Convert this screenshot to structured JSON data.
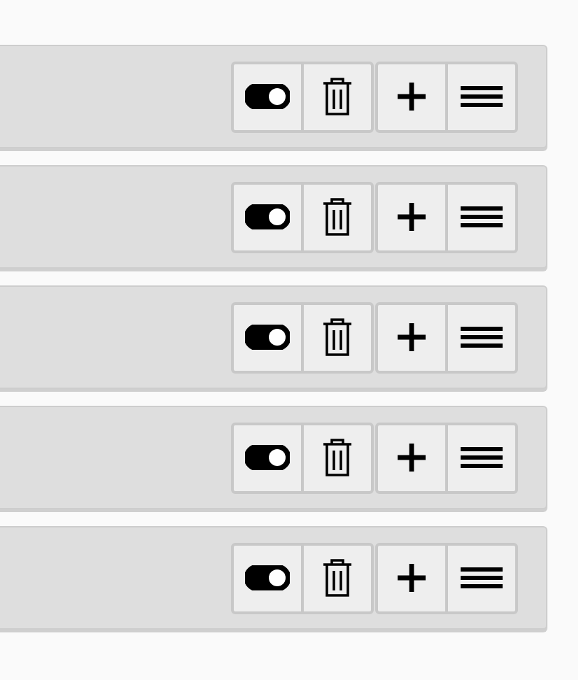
{
  "rows": [
    {
      "on": true
    },
    {
      "on": true
    },
    {
      "on": true
    },
    {
      "on": true
    },
    {
      "on": true
    }
  ]
}
